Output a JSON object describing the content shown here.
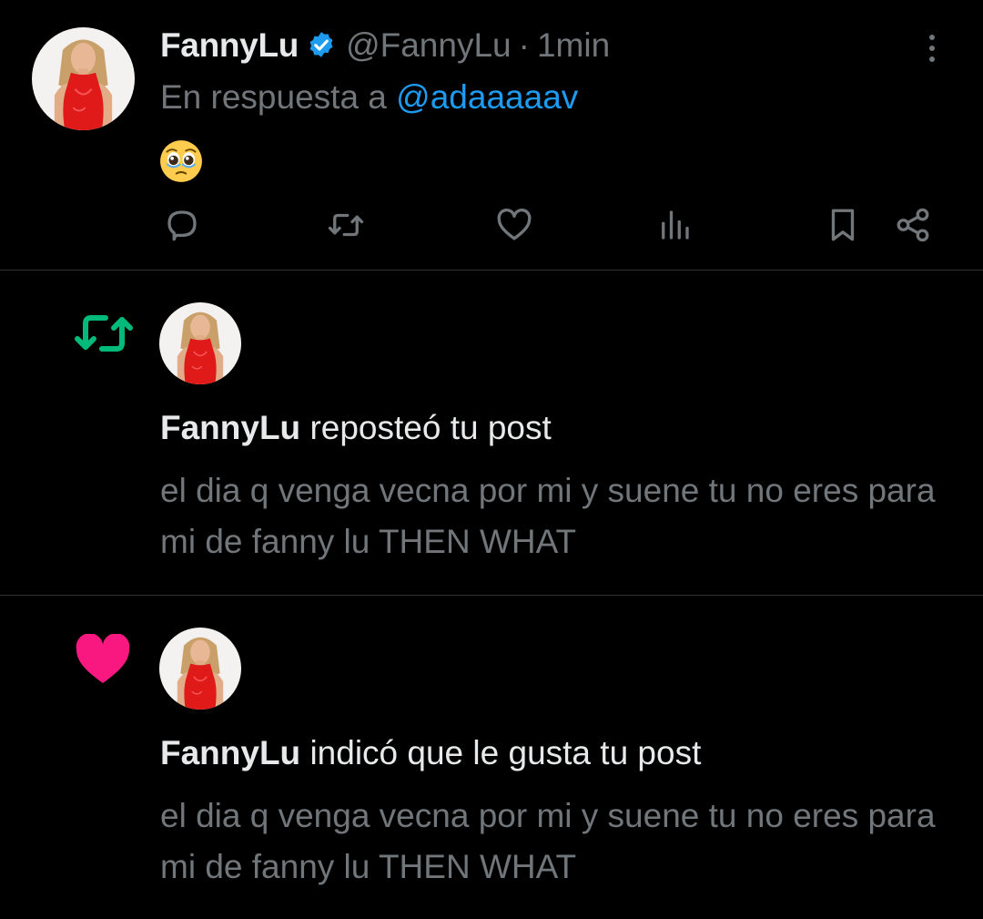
{
  "tweet": {
    "author_name": "FannyLu",
    "author_handle": "@FannyLu",
    "separator": "·",
    "time": "1min",
    "reply_prefix": "En respuesta a",
    "reply_mention": "@adaaaaav",
    "content_emoji": "🥹"
  },
  "notifications": [
    {
      "type": "repost",
      "icon": "repost-icon",
      "actor": "FannyLu",
      "action": "reposteó tu post",
      "post_text": "el dia q venga vecna por mi y suene tu no eres para mi de fanny lu THEN WHAT"
    },
    {
      "type": "like",
      "icon": "heart-icon",
      "actor": "FannyLu",
      "action": "indicó que le gusta tu post",
      "post_text": "el dia q venga vecna por mi y suene tu no eres para mi de fanny lu THEN WHAT"
    }
  ],
  "colors": {
    "background": "#000000",
    "divider": "#2f3336",
    "primary_text": "#e7e9ea",
    "secondary_text": "#71767b",
    "link": "#1d9bf0",
    "verified": "#1d9bf0",
    "repost_green": "#00ba7c",
    "like_pink": "#f91880"
  }
}
